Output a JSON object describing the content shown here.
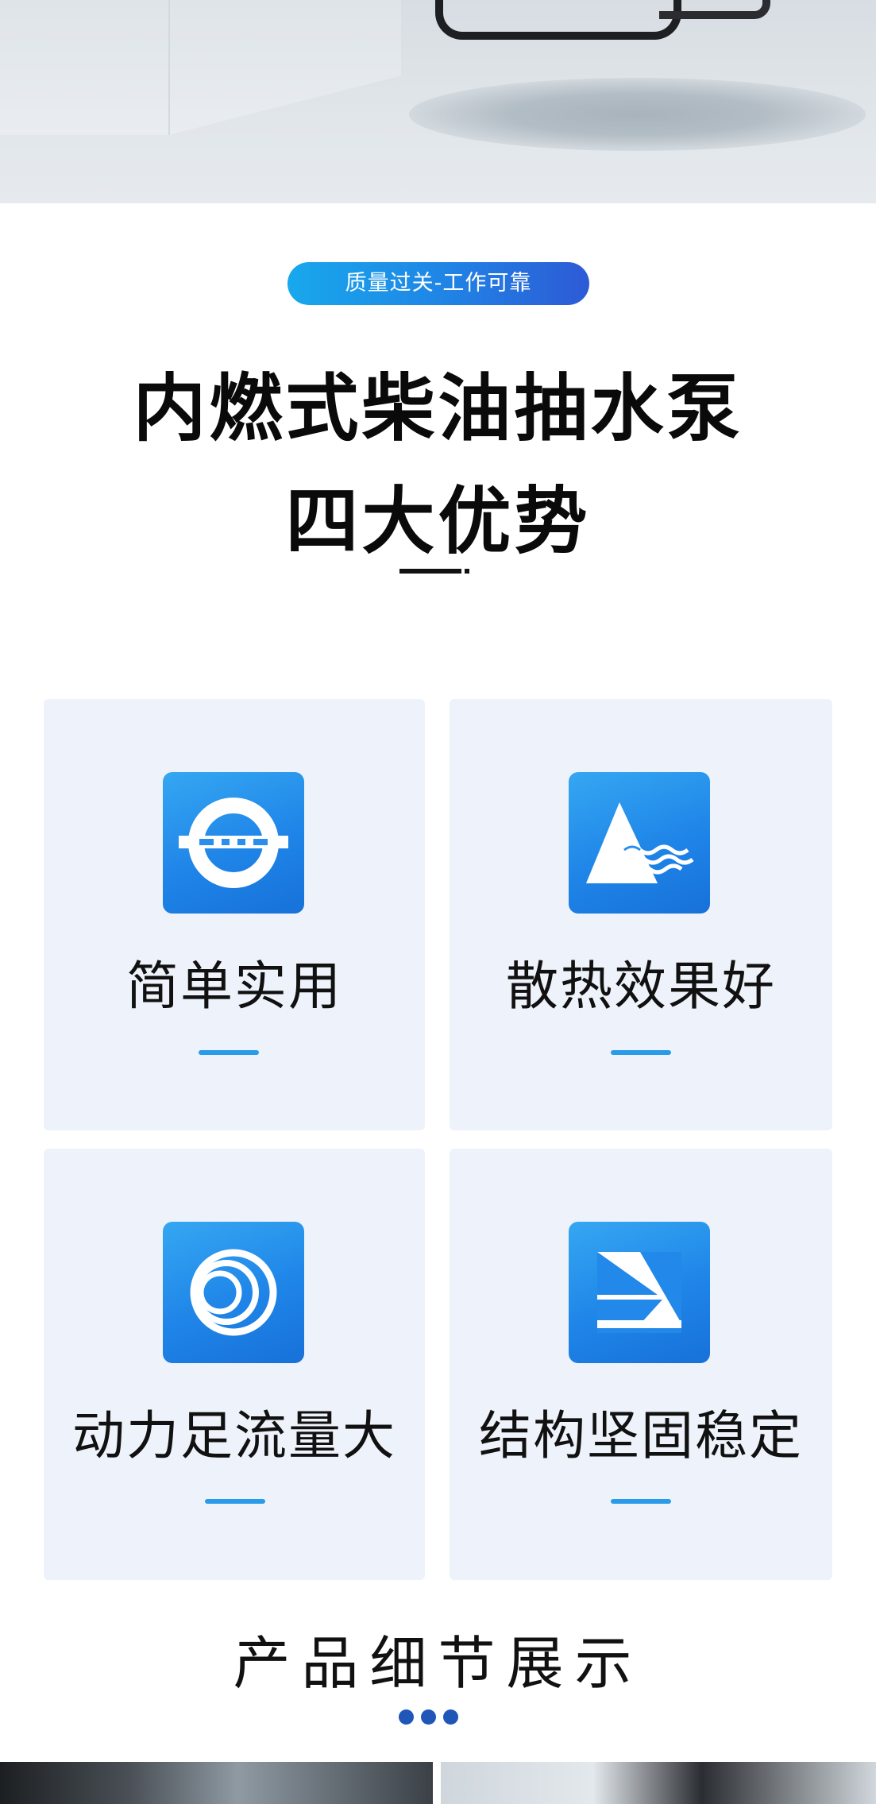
{
  "badge": {
    "text": "质量过关-工作可靠"
  },
  "headline": {
    "line1": "内燃式柴油抽水泵",
    "line2": "四大优势"
  },
  "features": [
    {
      "label": "简单实用",
      "icon": "ring-crossbar-icon"
    },
    {
      "label": "散热效果好",
      "icon": "triangle-waves-icon"
    },
    {
      "label": "动力足流量大",
      "icon": "concentric-rings-icon"
    },
    {
      "label": "结构坚固稳定",
      "icon": "split-triangle-icon"
    }
  ],
  "details": {
    "title": "产品细节展示"
  },
  "colors": {
    "accent": "#1f86e6",
    "card_bg": "#eef3fb",
    "dot": "#1f56b8"
  }
}
